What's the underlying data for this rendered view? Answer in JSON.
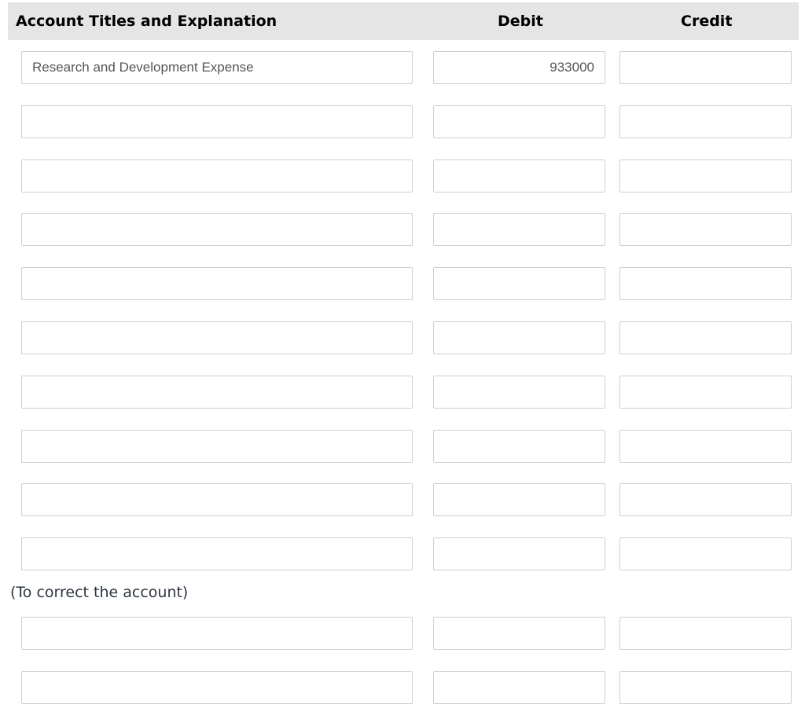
{
  "header": {
    "account_title": "Account Titles and Explanation",
    "debit": "Debit",
    "credit": "Credit"
  },
  "entries_group1": [
    {
      "account": "Research and Development Expense",
      "debit": "933000",
      "credit": ""
    },
    {
      "account": "",
      "debit": "",
      "credit": ""
    },
    {
      "account": "",
      "debit": "",
      "credit": ""
    },
    {
      "account": "",
      "debit": "",
      "credit": ""
    },
    {
      "account": "",
      "debit": "",
      "credit": ""
    },
    {
      "account": "",
      "debit": "",
      "credit": ""
    },
    {
      "account": "",
      "debit": "",
      "credit": ""
    },
    {
      "account": "",
      "debit": "",
      "credit": ""
    },
    {
      "account": "",
      "debit": "",
      "credit": ""
    },
    {
      "account": "",
      "debit": "",
      "credit": ""
    }
  ],
  "note": "(To correct the account)",
  "entries_group2": [
    {
      "account": "",
      "debit": "",
      "credit": ""
    },
    {
      "account": "",
      "debit": "",
      "credit": ""
    }
  ]
}
